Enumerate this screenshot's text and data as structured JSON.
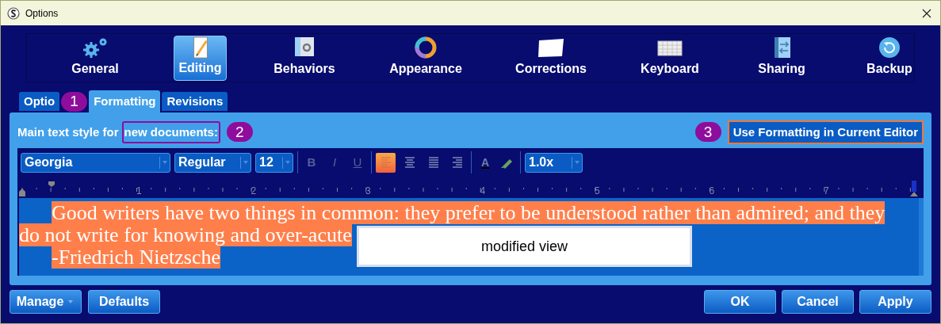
{
  "window": {
    "title": "Options"
  },
  "categories": [
    {
      "label": "General",
      "selected": false
    },
    {
      "label": "Editing",
      "selected": true
    },
    {
      "label": "Behaviors",
      "selected": false
    },
    {
      "label": "Appearance",
      "selected": false
    },
    {
      "label": "Corrections",
      "selected": false
    },
    {
      "label": "Keyboard",
      "selected": false
    },
    {
      "label": "Sharing",
      "selected": false
    },
    {
      "label": "Backup",
      "selected": false
    }
  ],
  "tabs": [
    {
      "label": "Optio",
      "selected": false
    },
    {
      "label": "Formatting",
      "selected": true
    },
    {
      "label": "Revisions",
      "selected": false
    }
  ],
  "tabs_callout": "1",
  "style_label": {
    "text": "Main text style for",
    "highlight": "new documents:",
    "callout": "2"
  },
  "current_editor_button": {
    "label": "Use Formatting in Current Editor",
    "callout": "3"
  },
  "format_toolbar": {
    "font": "Georgia",
    "style": "Regular",
    "size": "12",
    "text_buttons": [
      {
        "kind": "bold",
        "label": "B",
        "disabled": true
      },
      {
        "kind": "italic",
        "label": "I",
        "disabled": true
      },
      {
        "kind": "underline",
        "label": "U",
        "disabled": true
      }
    ],
    "alignment": [
      {
        "selected": true
      },
      {
        "selected": false
      },
      {
        "selected": false
      },
      {
        "selected": false
      }
    ],
    "text_color": {
      "label": "A"
    },
    "spacing": "1.0x"
  },
  "ruler": {
    "labels": [
      "1",
      "2",
      "3",
      "4",
      "5",
      "6",
      "7"
    ]
  },
  "editor": {
    "lines": [
      {
        "text": "Good writers have two things in common: they prefer to be understood rather than admired; and they",
        "indent": true
      },
      {
        "text": "do not write for knowing and over-acute",
        "indent": false
      },
      {
        "text": "-Friedrich Nietzsche",
        "indent": true
      }
    ],
    "overlay": "modified view"
  },
  "footer": {
    "left": [
      {
        "label": "Manage",
        "kind": "split"
      },
      {
        "label": "Defaults",
        "kind": "plain"
      }
    ],
    "right": [
      "OK",
      "Cancel",
      "Apply"
    ]
  }
}
